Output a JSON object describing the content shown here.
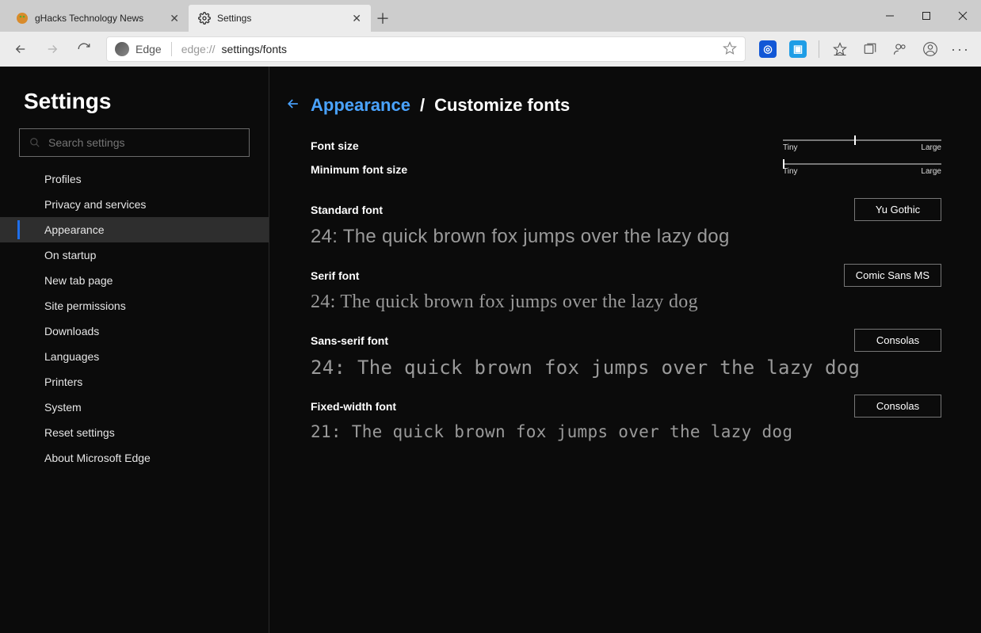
{
  "tabs": {
    "t0": {
      "title": "gHacks Technology News"
    },
    "t1": {
      "title": "Settings"
    }
  },
  "addressbar": {
    "edge_label": "Edge",
    "url_prefix": "edge://",
    "url_path": "settings/fonts"
  },
  "sidebar": {
    "title": "Settings",
    "search_placeholder": "Search settings",
    "items": {
      "profiles": "Profiles",
      "privacy": "Privacy and services",
      "appearance": "Appearance",
      "startup": "On startup",
      "newtab": "New tab page",
      "siteperm": "Site permissions",
      "downloads": "Downloads",
      "languages": "Languages",
      "printers": "Printers",
      "system": "System",
      "reset": "Reset settings",
      "about": "About Microsoft Edge"
    }
  },
  "breadcrumb": {
    "parent": "Appearance",
    "separator": "/",
    "current": "Customize fonts"
  },
  "sliders": {
    "font_size": {
      "label": "Font size",
      "min_label": "Tiny",
      "max_label": "Large"
    },
    "min_font_size": {
      "label": "Minimum font size",
      "min_label": "Tiny",
      "max_label": "Large"
    }
  },
  "fonts": {
    "standard": {
      "label": "Standard font",
      "button": "Yu Gothic",
      "preview": "24: The quick brown fox jumps over the lazy dog"
    },
    "serif": {
      "label": "Serif font",
      "button": "Comic Sans MS",
      "preview": "24: The quick brown fox jumps over the lazy dog"
    },
    "sans": {
      "label": "Sans-serif font",
      "button": "Consolas",
      "preview": "24: The quick brown fox jumps over the lazy dog"
    },
    "fixed": {
      "label": "Fixed-width font",
      "button": "Consolas",
      "preview": "21: The quick brown fox jumps over the lazy dog"
    }
  }
}
